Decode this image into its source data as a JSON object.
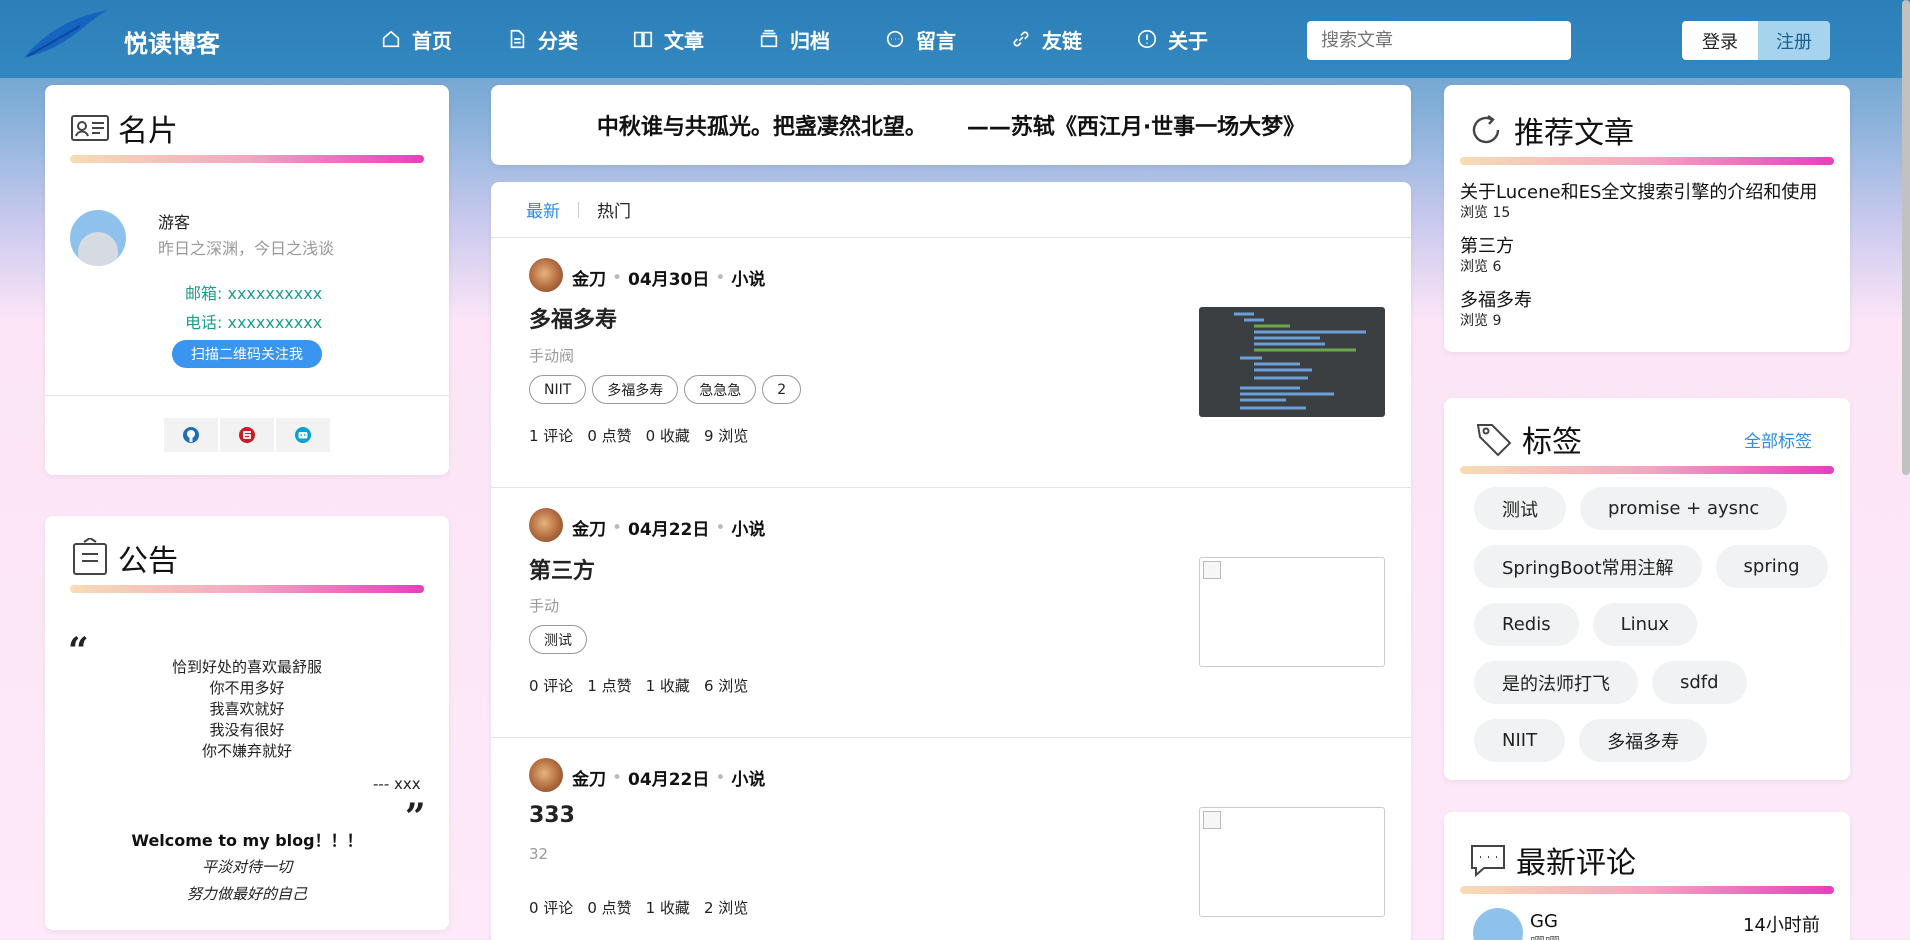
{
  "site": {
    "name": "悦读博客"
  },
  "nav": [
    {
      "label": "首页",
      "icon": "home-icon"
    },
    {
      "label": "分类",
      "icon": "document-icon"
    },
    {
      "label": "文章",
      "icon": "book-icon"
    },
    {
      "label": "归档",
      "icon": "archive-icon"
    },
    {
      "label": "留言",
      "icon": "chat-icon"
    },
    {
      "label": "友链",
      "icon": "link-icon"
    },
    {
      "label": "关于",
      "icon": "info-icon"
    }
  ],
  "search": {
    "placeholder": "搜索文章"
  },
  "auth": {
    "login": "登录",
    "register": "注册"
  },
  "profile": {
    "title": "名片",
    "name": "游客",
    "motto": "昨日之深渊，今日之浅谈",
    "email": "邮箱: xxxxxxxxxx",
    "phone": "电话: xxxxxxxxxx",
    "qr_button": "扫描二维码关注我",
    "social": [
      "github-icon",
      "gitee-icon",
      "bilibili-icon"
    ]
  },
  "notice": {
    "title": "公告",
    "open_quote": "“",
    "close_quote": "”",
    "lines": [
      "恰到好处的喜欢最舒服",
      "你不用多好",
      "我喜欢就好",
      "我没有很好",
      "你不嫌弃就好"
    ],
    "signature": "--- xxx",
    "welcome": "Welcome to my blog！！！",
    "italic1": "平淡对待一切",
    "italic2": "努力做最好的自己"
  },
  "quote": {
    "text": "中秋谁与共孤光。把盏凄然北望。",
    "source": "——苏轼《西江月·世事一场大梦》"
  },
  "tabs": {
    "latest": "最新",
    "hot": "热门"
  },
  "articles": [
    {
      "author": "金刀",
      "date": "04月30日",
      "category": "小说",
      "title": "多福多寿",
      "desc": "手动阀",
      "tags": [
        "NIIT",
        "多福多寿",
        "急急急",
        "2"
      ],
      "comments": "1 评论",
      "likes": "0 点赞",
      "favorites": "0 收藏",
      "views": "9 浏览"
    },
    {
      "author": "金刀",
      "date": "04月22日",
      "category": "小说",
      "title": "第三方",
      "desc": "手动",
      "tags": [
        "测试"
      ],
      "comments": "0 评论",
      "likes": "1 点赞",
      "favorites": "1 收藏",
      "views": "6 浏览"
    },
    {
      "author": "金刀",
      "date": "04月22日",
      "category": "小说",
      "title": "333",
      "desc": "32",
      "tags": [],
      "comments": "0 评论",
      "likes": "0 点赞",
      "favorites": "1 收藏",
      "views": "2 浏览"
    }
  ],
  "recommend": {
    "title": "推荐文章",
    "items": [
      {
        "title": "关于Lucene和ES全文搜索引擎的介绍和使用",
        "views": "浏览  15"
      },
      {
        "title": "第三方",
        "views": "浏览  6"
      },
      {
        "title": "多福多寿",
        "views": "浏览  9"
      }
    ]
  },
  "tags_card": {
    "title": "标签",
    "all": "全部标签",
    "items": [
      "测试",
      "promise + aysnc",
      "SpringBoot常用注解",
      "spring",
      "Redis",
      "Linux",
      "是的法师打飞",
      "sdfd",
      "NIIT",
      "多福多寿"
    ]
  },
  "comments_card": {
    "title": "最新评论",
    "name": "GG",
    "time": "14小时前",
    "text": "嘤嘤"
  },
  "colors": {
    "nav_bg": "#2c7fb8",
    "accent": "#2f8be0",
    "contact": "#1b9e8e",
    "qr_btn": "#3a95f0"
  }
}
